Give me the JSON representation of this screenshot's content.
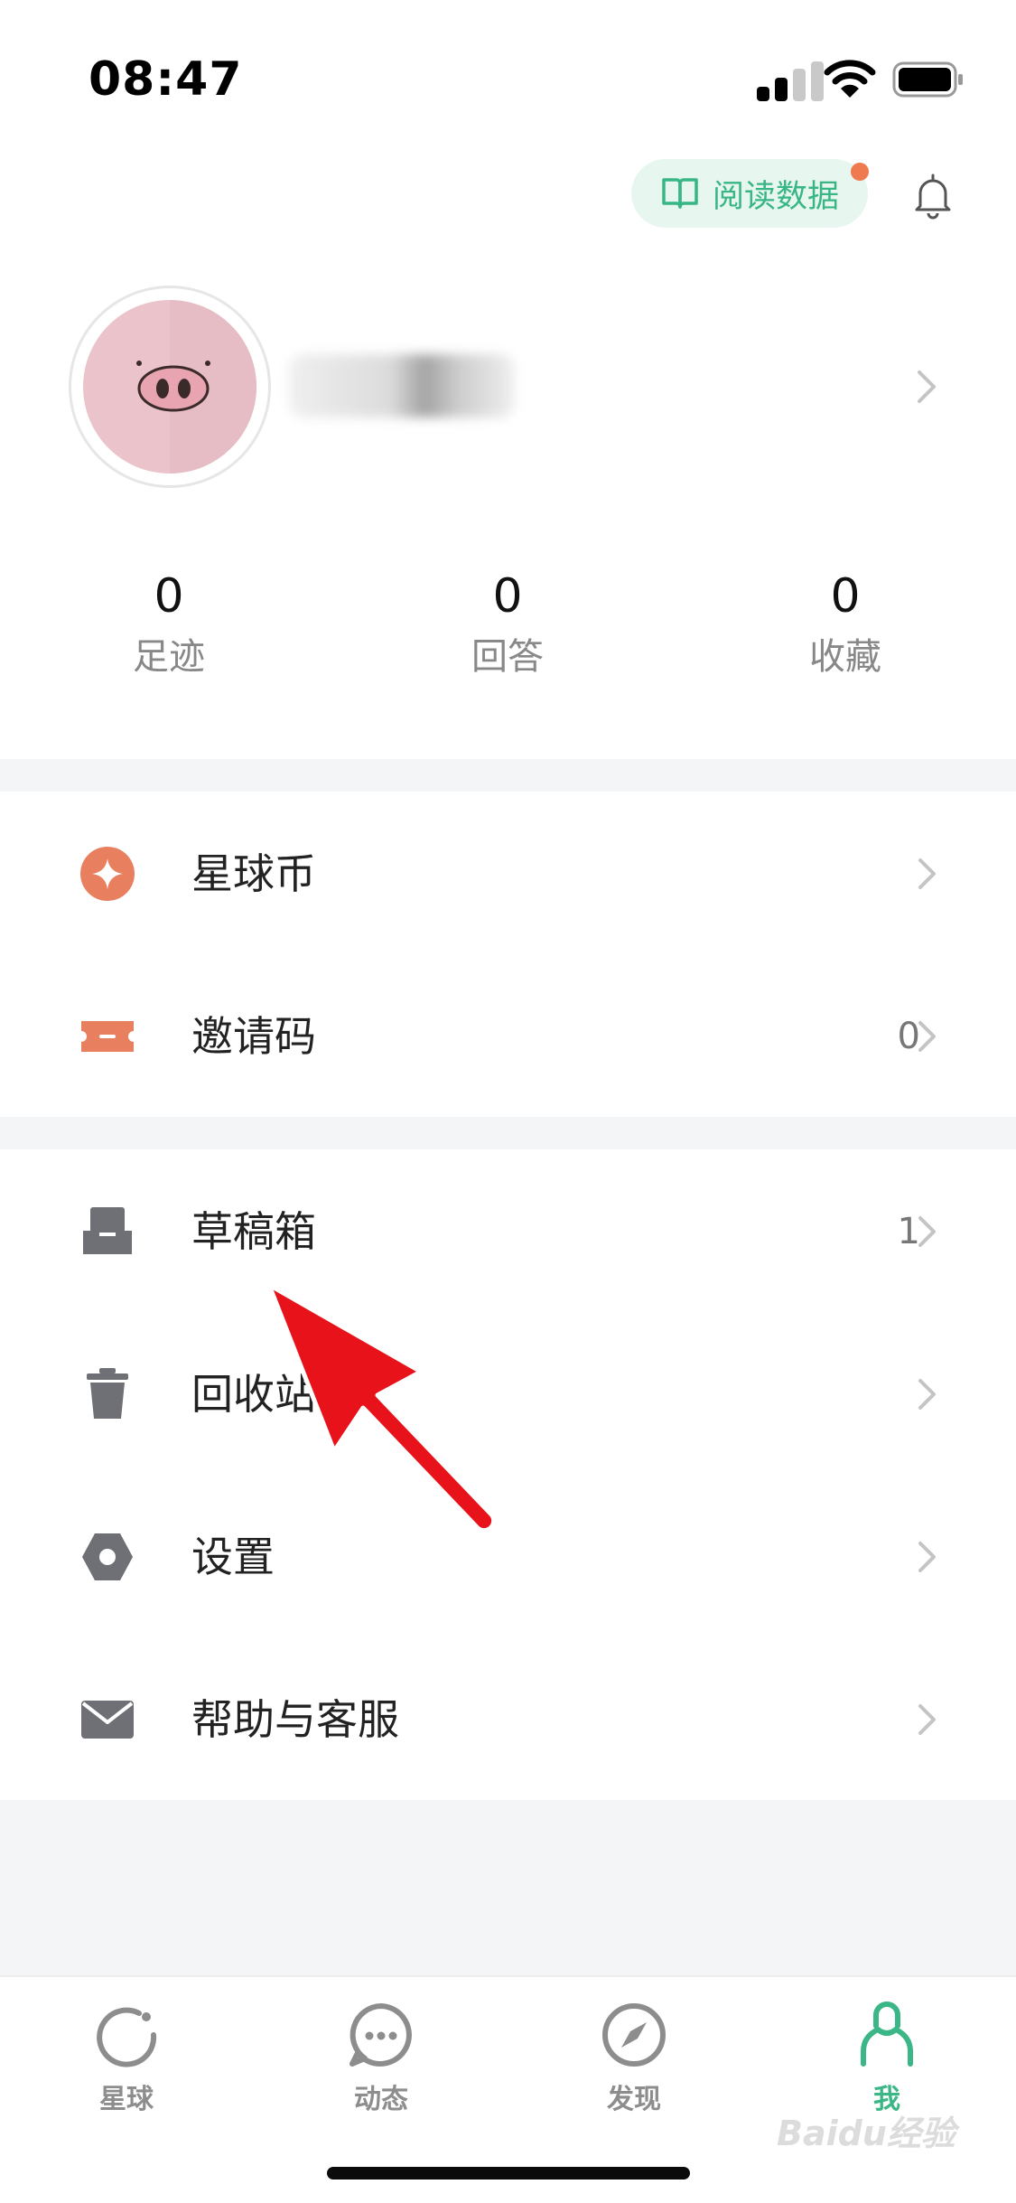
{
  "status_bar": {
    "time": "08:47"
  },
  "header": {
    "read_data_label": "阅读数据"
  },
  "stats": [
    {
      "value": "0",
      "label": "足迹"
    },
    {
      "value": "0",
      "label": "回答"
    },
    {
      "value": "0",
      "label": "收藏"
    }
  ],
  "menu_group_1": [
    {
      "label": "星球币",
      "value": "",
      "icon": "star-coin-icon"
    },
    {
      "label": "邀请码",
      "value": "0",
      "icon": "ticket-icon"
    }
  ],
  "menu_group_2": [
    {
      "label": "草稿箱",
      "value": "1",
      "icon": "drafts-tray-icon"
    },
    {
      "label": "回收站",
      "value": "",
      "icon": "trash-icon"
    },
    {
      "label": "设置",
      "value": "",
      "icon": "settings-hex-icon"
    },
    {
      "label": "帮助与客服",
      "value": "",
      "icon": "mail-icon"
    }
  ],
  "tabbar": [
    {
      "label": "星球",
      "icon": "planet-icon",
      "active": false
    },
    {
      "label": "动态",
      "icon": "chat-bubble-icon",
      "active": false
    },
    {
      "label": "发现",
      "icon": "compass-icon",
      "active": false
    },
    {
      "label": "我",
      "icon": "person-icon",
      "active": true
    }
  ],
  "colors": {
    "accent_green": "#3bb686",
    "accent_orange": "#e8805f",
    "icon_gray": "#6f7075",
    "arrow_red": "#e8121b"
  },
  "watermark": "Baidu经验"
}
